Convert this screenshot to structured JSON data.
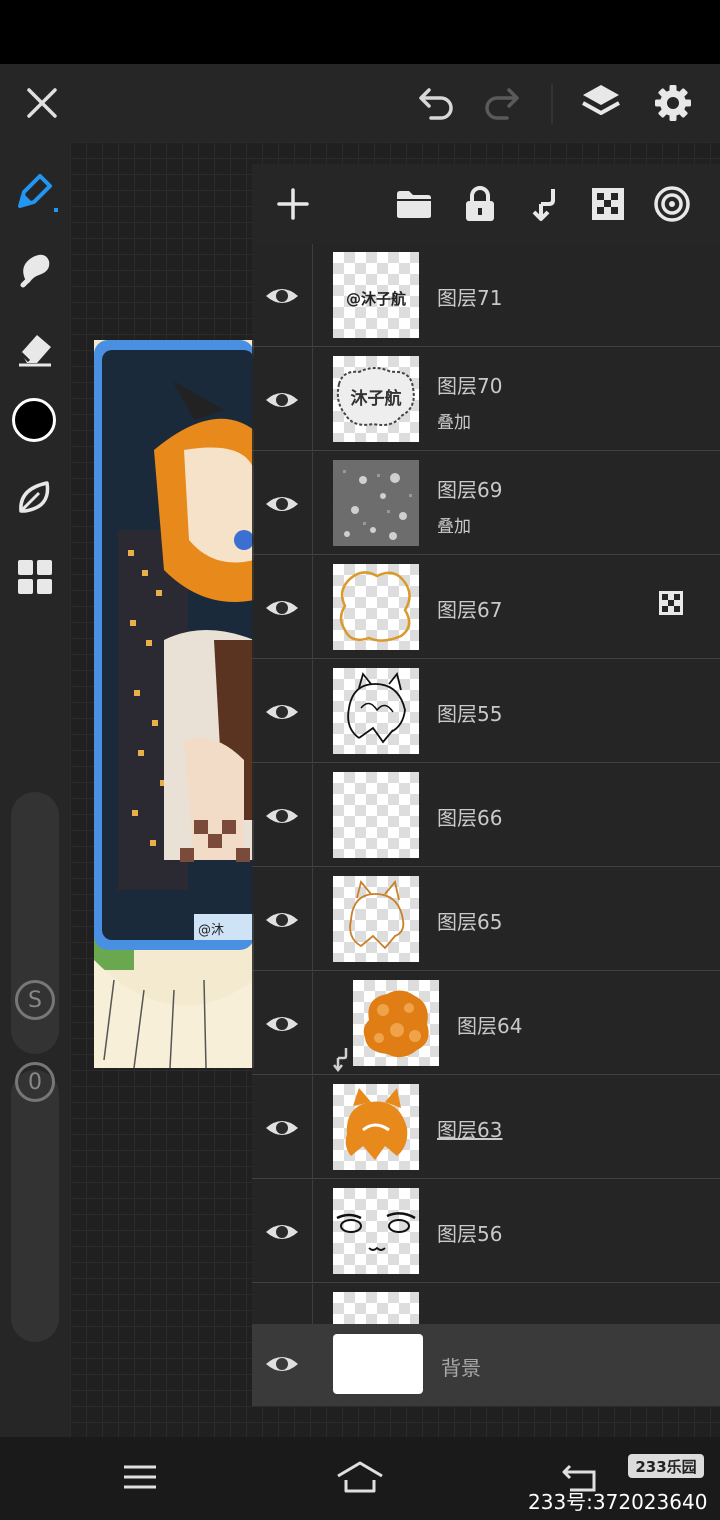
{
  "app": {
    "accent_color": "#2196f3",
    "bg_color": "#1f1f1f"
  },
  "top_bar": {
    "icons": [
      "close-icon",
      "undo-icon",
      "redo-icon",
      "layers-icon",
      "settings-icon"
    ]
  },
  "left_toolbar": {
    "tools": [
      "brush-icon",
      "smudge-icon",
      "eraser-icon",
      "color-picker",
      "blur-leaf-icon",
      "grid-menu-icon"
    ],
    "active_tool": "brush-icon",
    "current_color": "#000000",
    "size_badge": "S",
    "opacity_badge": "0"
  },
  "layers_toolbar": {
    "icons": [
      "add-layer-icon",
      "folder-icon",
      "lock-icon",
      "clip-arrow-icon",
      "checker-icon",
      "target-icon"
    ]
  },
  "layers": [
    {
      "name": "图层71",
      "mode": "",
      "clipped": false,
      "alpha_lock": false,
      "underlined": false
    },
    {
      "name": "图层70",
      "mode": "叠加",
      "clipped": false,
      "alpha_lock": false,
      "underlined": false
    },
    {
      "name": "图层69",
      "mode": "叠加",
      "clipped": false,
      "alpha_lock": false,
      "underlined": false
    },
    {
      "name": "图层67",
      "mode": "",
      "clipped": false,
      "alpha_lock": true,
      "underlined": false
    },
    {
      "name": "图层55",
      "mode": "",
      "clipped": false,
      "alpha_lock": false,
      "underlined": false
    },
    {
      "name": "图层66",
      "mode": "",
      "clipped": false,
      "alpha_lock": false,
      "underlined": false
    },
    {
      "name": "图层65",
      "mode": "",
      "clipped": false,
      "alpha_lock": false,
      "underlined": false
    },
    {
      "name": "图层64",
      "mode": "",
      "clipped": true,
      "alpha_lock": false,
      "underlined": false
    },
    {
      "name": "图层63",
      "mode": "",
      "clipped": false,
      "alpha_lock": false,
      "underlined": true
    },
    {
      "name": "图层56",
      "mode": "",
      "clipped": false,
      "alpha_lock": false,
      "underlined": false
    }
  ],
  "background_layer": {
    "name": "背景"
  },
  "thumb_text": {
    "layer71": "@沐子航",
    "layer70": "沐子航"
  },
  "canvas": {
    "signature": "@沐"
  },
  "nav_bar": {
    "icons": [
      "menu-icon",
      "home-icon",
      "back-icon"
    ]
  },
  "watermark": {
    "badge": "233乐园",
    "id_text": "233号:372023640"
  }
}
